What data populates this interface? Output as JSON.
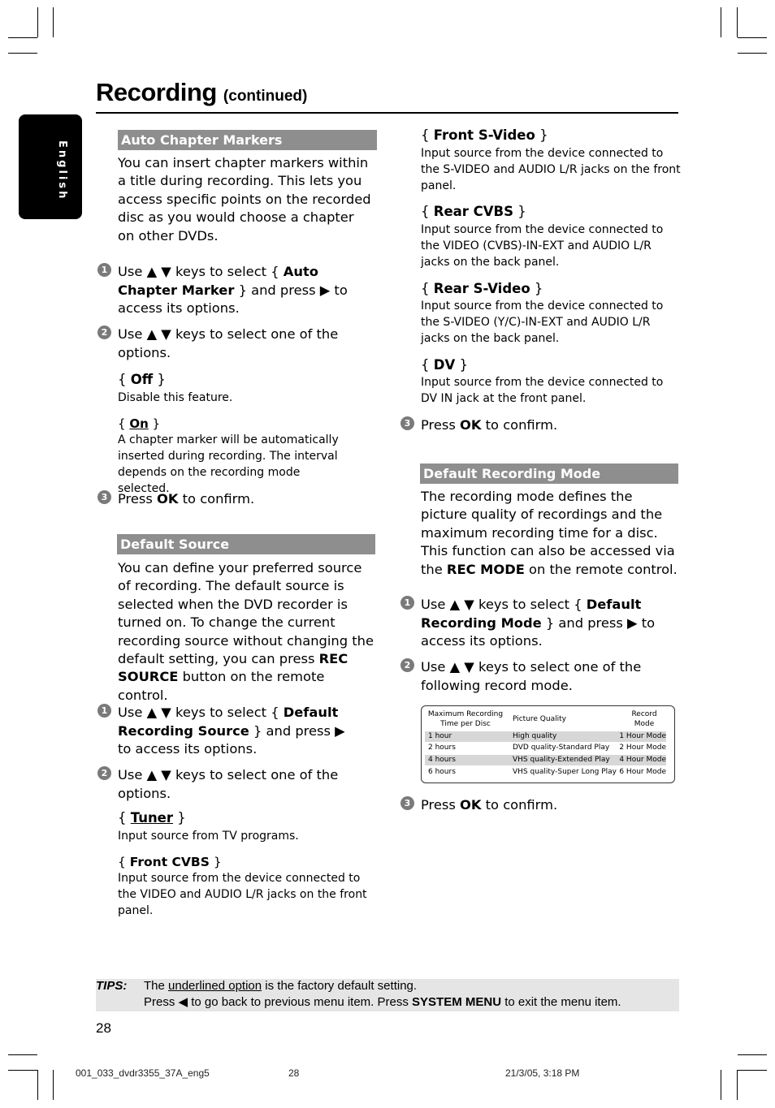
{
  "header": {
    "title": "Recording",
    "subtitle": "(continued)"
  },
  "language_tab": "English",
  "arrows": {
    "up": "▲",
    "down": "▼",
    "right": "▶",
    "left": "◀"
  },
  "auto_chapter": {
    "heading": "Auto Chapter Markers",
    "intro": "You can insert chapter markers within a title during recording.  This lets you access specific points on the recorded disc as you would choose a chapter on other DVDs.",
    "step1": {
      "num": "1",
      "pre": "Use ▲ ▼ keys to select { ",
      "bold": "Auto Chapter Marker",
      "post": " } and press ▶ to access its options."
    },
    "step2": {
      "num": "2",
      "text": "Use ▲ ▼ keys to select one of the options."
    },
    "options": [
      {
        "label": "Off",
        "underlined": false,
        "desc": "Disable this feature."
      },
      {
        "label": "On",
        "underlined": true,
        "desc": "A chapter marker will be automatically inserted during recording. The interval depends on the recording mode selected."
      }
    ],
    "step3": {
      "num": "3",
      "pre": "Press ",
      "bold": "OK",
      "post": " to confirm."
    }
  },
  "default_source": {
    "heading": "Default Source",
    "intro_pre": "You can define your preferred source of recording. The default source is selected when the DVD recorder is turned on. To change the current recording source without changing the default setting, you can press ",
    "intro_bold": "REC SOURCE",
    "intro_post": " button on the remote control.",
    "step1": {
      "num": "1",
      "pre": "Use ▲ ▼ keys to select { ",
      "bold": "Default Recording Source",
      "post": " } and press ▶ to access its options."
    },
    "step2": {
      "num": "2",
      "text": "Use ▲ ▼ keys to select one of the options."
    },
    "options": [
      {
        "label": "Tuner",
        "underlined": true,
        "desc": "Input source from TV programs."
      },
      {
        "label": "Front CVBS",
        "underlined": false,
        "desc": "Input source from the device connected to the VIDEO and AUDIO L/R jacks on the front panel."
      },
      {
        "label": "Front S-Video",
        "underlined": false,
        "desc": "Input source from the device connected to the S-VIDEO and AUDIO L/R jacks on the front panel."
      },
      {
        "label": "Rear CVBS",
        "underlined": false,
        "desc": "Input source from the device connected to the VIDEO (CVBS)-IN-EXT and AUDIO L/R jacks on the back panel."
      },
      {
        "label": "Rear S-Video",
        "underlined": false,
        "desc": "Input source from the device connected to the S-VIDEO (Y/C)-IN-EXT and AUDIO L/R jacks on the back panel."
      },
      {
        "label": "DV",
        "underlined": false,
        "desc": "Input source from the device connected to DV IN jack at the front panel."
      }
    ],
    "step3": {
      "num": "3",
      "pre": "Press ",
      "bold": "OK",
      "post": " to confirm."
    }
  },
  "default_mode": {
    "heading": "Default Recording Mode",
    "intro_pre": "The recording mode defines the picture quality of recordings and the maximum recording time for a disc. This function can also be accessed via the ",
    "intro_bold": "REC MODE",
    "intro_post": " on the remote control.",
    "step1": {
      "num": "1",
      "pre": "Use ▲ ▼ keys to select { ",
      "bold": "Default Recording Mode",
      "post": " } and press ▶ to access its options."
    },
    "step2": {
      "num": "2",
      "text": "Use ▲ ▼ keys to select one of the following record mode."
    },
    "table": {
      "headers": [
        "Maximum Recording Time per Disc",
        "Picture Quality",
        "Record Mode"
      ],
      "rows": [
        [
          "1 hour",
          "High quality",
          "1 Hour Mode"
        ],
        [
          "2 hours",
          "DVD quality-Standard Play",
          "2 Hour Mode"
        ],
        [
          "4 hours",
          "VHS quality-Extended Play",
          "4 Hour Mode"
        ],
        [
          "6 hours",
          "VHS quality-Super Long Play",
          "6 Hour Mode"
        ]
      ]
    },
    "step3": {
      "num": "3",
      "pre": "Press ",
      "bold": "OK",
      "post": " to confirm."
    }
  },
  "tips": {
    "label": "TIPS:",
    "line1_pre": "The ",
    "line1_u": "underlined option",
    "line1_post": " is the factory default  setting.",
    "line2_pre": "Press ◀  to go back to previous menu item. Press ",
    "line2_bold": "SYSTEM MENU",
    "line2_post": " to exit the menu item."
  },
  "page_number": "28",
  "footer": {
    "file": "001_033_dvdr3355_37A_eng5",
    "page": "28",
    "timestamp": "21/3/05, 3:18 PM"
  }
}
